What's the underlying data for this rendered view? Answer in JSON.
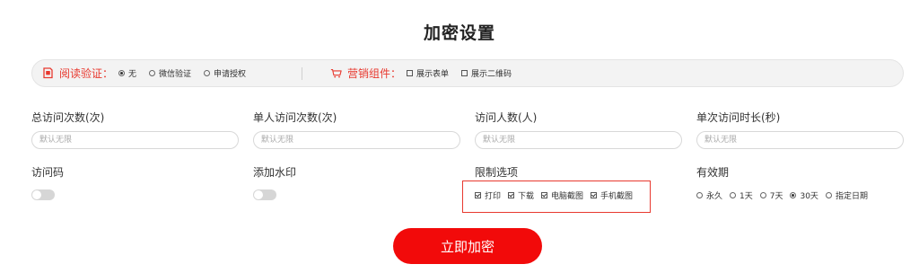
{
  "page": {
    "title": "加密设置"
  },
  "reading_verify": {
    "label": "阅读验证：",
    "options": [
      {
        "label": "无",
        "selected": true
      },
      {
        "label": "微信验证",
        "selected": false
      },
      {
        "label": "申请授权",
        "selected": false
      }
    ]
  },
  "marketing": {
    "label": "营销组件：",
    "options": [
      {
        "label": "展示表单",
        "checked": false
      },
      {
        "label": "展示二维码",
        "checked": false
      }
    ]
  },
  "fields": {
    "total_visits": {
      "label": "总访问次数(次)",
      "placeholder": "默认无限"
    },
    "per_person_visits": {
      "label": "单人访问次数(次)",
      "placeholder": "默认无限"
    },
    "visitors": {
      "label": "访问人数(人)",
      "placeholder": "默认无限"
    },
    "single_duration": {
      "label": "单次访问时长(秒)",
      "placeholder": "默认无限"
    }
  },
  "access_code": {
    "label": "访问码",
    "enabled": false
  },
  "watermark": {
    "label": "添加水印",
    "enabled": false
  },
  "restrictions": {
    "label": "限制选项",
    "options": [
      {
        "label": "打印",
        "checked": true
      },
      {
        "label": "下载",
        "checked": true
      },
      {
        "label": "电脑截图",
        "checked": true
      },
      {
        "label": "手机截图",
        "checked": true
      }
    ]
  },
  "validity": {
    "label": "有效期",
    "options": [
      {
        "label": "永久",
        "selected": false
      },
      {
        "label": "1天",
        "selected": false
      },
      {
        "label": "7天",
        "selected": false
      },
      {
        "label": "30天",
        "selected": true
      },
      {
        "label": "指定日期",
        "selected": false
      }
    ]
  },
  "submit": {
    "label": "立即加密"
  },
  "colors": {
    "accent": "#e8392f",
    "button": "#f20a0a"
  }
}
